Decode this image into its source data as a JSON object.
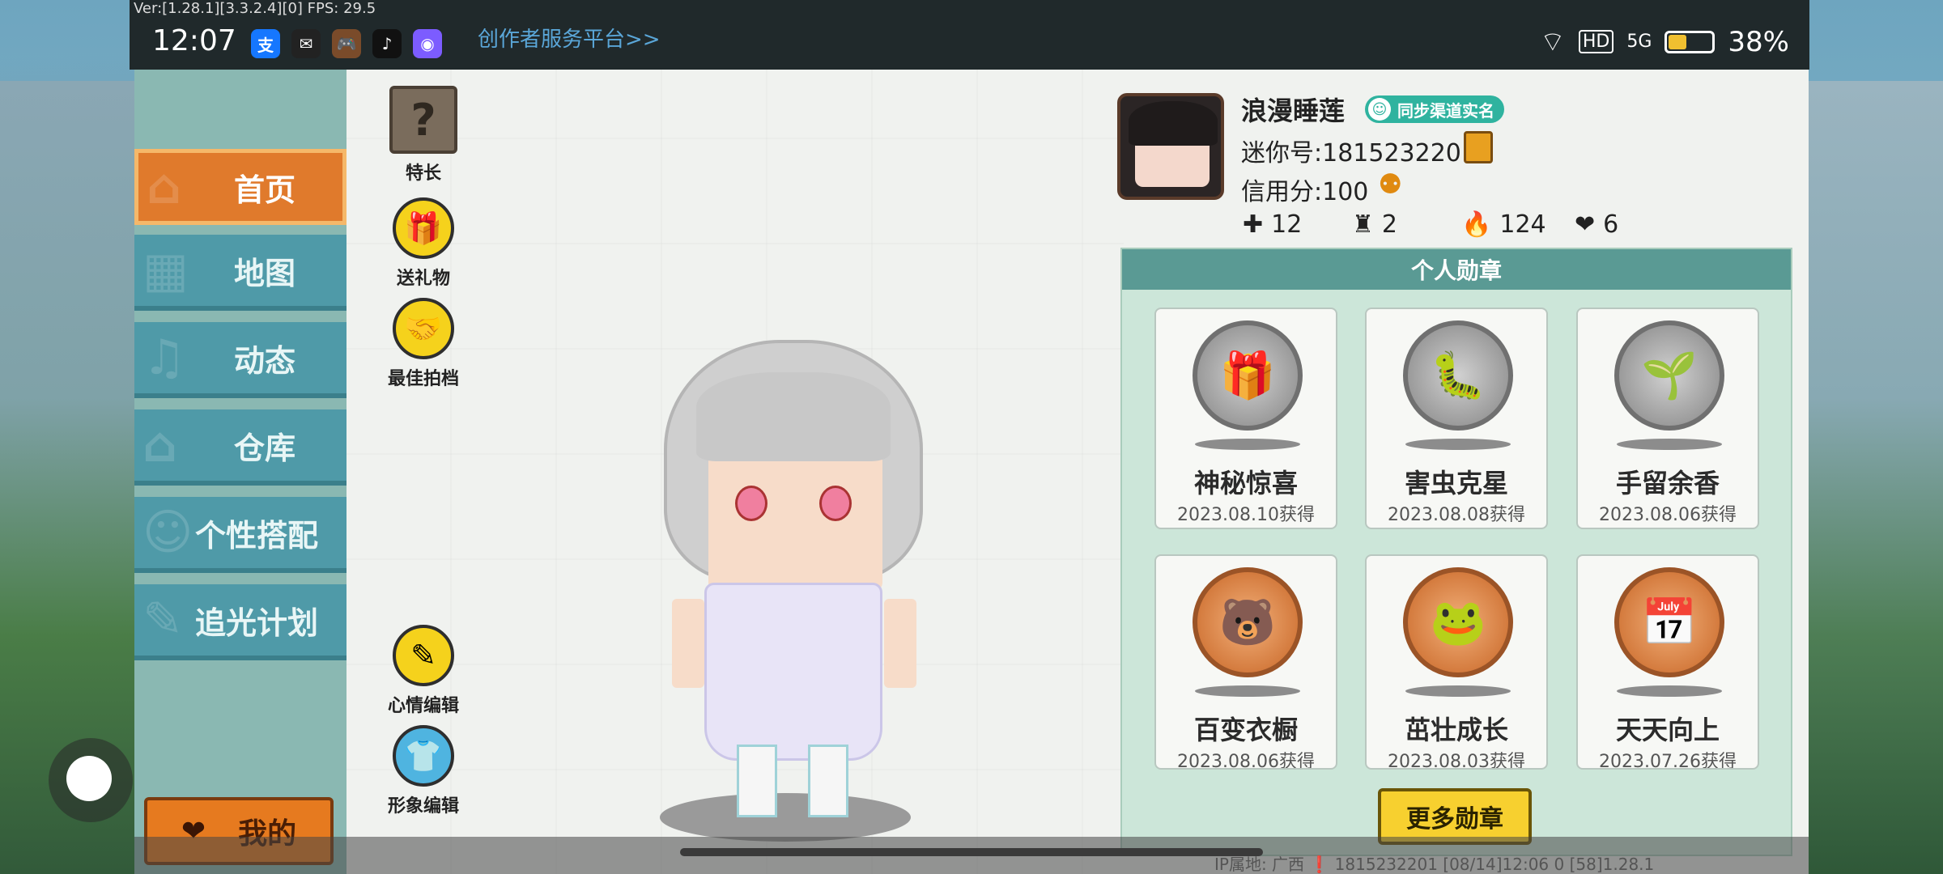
{
  "status_bar": {
    "fps_text": "Ver:[1.28.1][3.3.2.4][0] FPS: 29.5",
    "time": "12:07",
    "app_icons": [
      "支",
      "✉",
      "🎮",
      "♪",
      "◉"
    ],
    "creator_link": "创作者服务平台>>",
    "network": "HD",
    "signal": "5G",
    "battery_percent": "38%"
  },
  "sidebar": {
    "items": [
      {
        "label": "首页",
        "icon": "home-icon",
        "active": true
      },
      {
        "label": "地图",
        "icon": "map-icon"
      },
      {
        "label": "动态",
        "icon": "bell-icon"
      },
      {
        "label": "仓库",
        "icon": "warehouse-icon"
      },
      {
        "label": "个性搭配",
        "icon": "outfit-icon"
      },
      {
        "label": "追光计划",
        "icon": "plan-icon"
      }
    ],
    "my_button": "我的"
  },
  "tools": {
    "specialty": "特长",
    "send_gift": "送礼物",
    "best_photo": "最佳拍档",
    "mood_edit": "心情编辑",
    "image_edit": "形象编辑"
  },
  "profile": {
    "username": "浪漫睡莲",
    "verify_badge": "同步渠道实名",
    "mini_id": "迷你号:1815232201",
    "credit": "信用分:100",
    "stats": [
      {
        "icon": "plus-icon",
        "value": "12"
      },
      {
        "icon": "trophy-icon",
        "value": "2"
      },
      {
        "icon": "fire-icon",
        "value": "124"
      },
      {
        "icon": "heart-icon",
        "value": "6"
      }
    ]
  },
  "medals": {
    "title": "个人勋章",
    "items": [
      {
        "name": "神秘惊喜",
        "date": "2023.08.10获得",
        "style": "silver",
        "glyph": "🎁"
      },
      {
        "name": "害虫克星",
        "date": "2023.08.08获得",
        "style": "silver",
        "glyph": "🐛"
      },
      {
        "name": "手留余香",
        "date": "2023.08.06获得",
        "style": "silver",
        "glyph": "🌱"
      },
      {
        "name": "百变衣橱",
        "date": "2023.08.06获得",
        "style": "bronze",
        "glyph": "🐻"
      },
      {
        "name": "茁壮成长",
        "date": "2023.08.03获得",
        "style": "bronze",
        "glyph": "🐸"
      },
      {
        "name": "天天向上",
        "date": "2023.07.26获得",
        "style": "bronze",
        "glyph": "📅"
      }
    ],
    "more_button": "更多勋章"
  },
  "footer": {
    "info": "IP属地: 广西 ❗    1815232201   [08/14]12:06 0  [58]1.28.1"
  }
}
